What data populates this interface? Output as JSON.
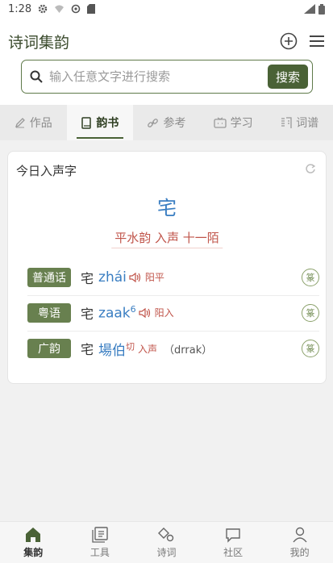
{
  "status": {
    "time": "1:28"
  },
  "app": {
    "title": "诗词集韵"
  },
  "search": {
    "placeholder": "输入任意文字进行搜索",
    "button_label": "搜索"
  },
  "tabs": [
    {
      "label": "作品",
      "icon": "pen-icon"
    },
    {
      "label": "韵书",
      "icon": "book-icon",
      "active": true
    },
    {
      "label": "参考",
      "icon": "link-icon"
    },
    {
      "label": "学习",
      "icon": "tv-icon"
    },
    {
      "label": "词谱",
      "icon": "ci-icon"
    }
  ],
  "card": {
    "title": "今日入声字",
    "character": "宅",
    "rhyme": "平水韵 入声 十一陌",
    "pronunciations": [
      {
        "tag": "普通话",
        "char": "宅",
        "value": "zhái",
        "sup": "",
        "tone": "阳平",
        "extra": ""
      },
      {
        "tag": "粤语",
        "char": "宅",
        "value": "zaak",
        "sup": "6",
        "tone": "阳入",
        "extra": ""
      },
      {
        "tag": "广韵",
        "char": "宅",
        "value": "場伯",
        "sup": "切",
        "tone": "入声",
        "extra": "（drrak）"
      }
    ]
  },
  "bottom_nav": [
    {
      "label": "集韵",
      "active": true
    },
    {
      "label": "工具"
    },
    {
      "label": "诗词"
    },
    {
      "label": "社区"
    },
    {
      "label": "我的"
    }
  ],
  "colors": {
    "accent": "#4a6236",
    "blue": "#3a7ec2",
    "red": "#c0544a"
  }
}
